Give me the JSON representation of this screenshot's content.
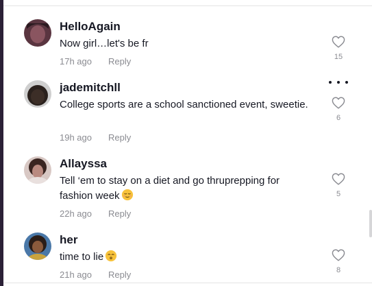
{
  "comments": [
    {
      "username": "HelloAgain",
      "text": "Now girl…let's be fr",
      "emoji": "",
      "emoji_name": "",
      "time": "17h ago",
      "reply_label": "Reply",
      "likes": "15",
      "avatar_color": "#6b3f49"
    },
    {
      "username": "jademitchll",
      "text": "College sports are a school sanctioned event, sweetie.",
      "emoji": "",
      "emoji_name": "",
      "time": "19h ago",
      "reply_label": "Reply",
      "likes": "6",
      "avatar_color": "#2e2622"
    },
    {
      "username": "Allayssa",
      "text": "Tell ‘em to stay on a diet and go thruprepping for fashion week",
      "emoji": "😌",
      "emoji_name": "relieved-face-emoji",
      "time": "22h ago",
      "reply_label": "Reply",
      "likes": "5",
      "avatar_color": "#a77d78"
    },
    {
      "username": "her",
      "text": "time to lie",
      "emoji": "😙",
      "emoji_name": "kissing-face-emoji",
      "time": "21h ago",
      "reply_label": "Reply",
      "likes": "8",
      "avatar_color": "#3e5f86"
    }
  ],
  "colors": {
    "text": "#161823",
    "muted": "#8a8b91",
    "divider": "#e3e3e4",
    "emoji_face": "#f7c23b"
  },
  "icons": {
    "like": "heart-outline-icon",
    "more": "more-horizontal-icon"
  }
}
